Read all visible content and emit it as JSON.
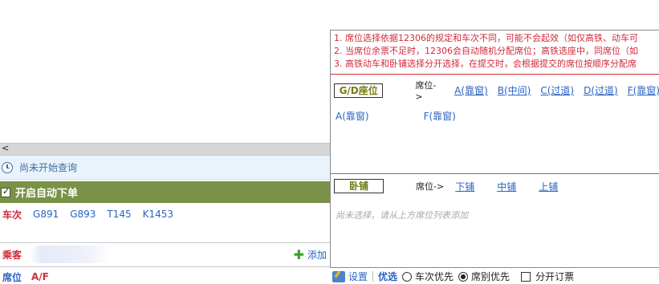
{
  "left": {
    "scroll_arrow": "<",
    "status_text": "尚未开始查询",
    "auto_order_label": "开启自动下单",
    "train_label": "车次",
    "trains": [
      "G891",
      "G893",
      "T145",
      "K1453"
    ],
    "passenger_label": "乘客",
    "add_label": "添加",
    "seat_label": "席位",
    "seat_value": "A/F"
  },
  "popup": {
    "notes": [
      "1. 席位选择依据12306的规定和车次不同，可能不会起效（如仅高铁、动车可",
      "2. 当席位余票不足时，12306会自动随机分配席位；高铁选座中，同席位（如",
      "3. 高铁动车和卧铺选择分开选择，在提交时，会根据提交的席位按顺序分配席"
    ],
    "gd": {
      "tag": "G/D座位",
      "head_label": "席位->",
      "options": [
        "A(靠窗)",
        "B(中间)",
        "C(过道)",
        "D(过道)",
        "F(靠窗)"
      ],
      "selected": [
        "A(靠窗)",
        "F(靠窗)"
      ]
    },
    "sleeper": {
      "tag": "卧铺",
      "head_label": "席位->",
      "options": [
        "下铺",
        "中铺",
        "上铺"
      ],
      "empty_hint": "尚未选择，请从上方席位列表添加"
    }
  },
  "toolbar": {
    "settings_label": "设置",
    "priority_label": "优选",
    "opt_train_first": "车次优先",
    "opt_seat_first": "席别优先",
    "opt_split": "分开订票",
    "selected_priority": "席别优先"
  },
  "colors": {
    "accent_red": "#d4283a",
    "link_blue": "#2a63c4",
    "auto_bar_green": "#7a9148"
  }
}
